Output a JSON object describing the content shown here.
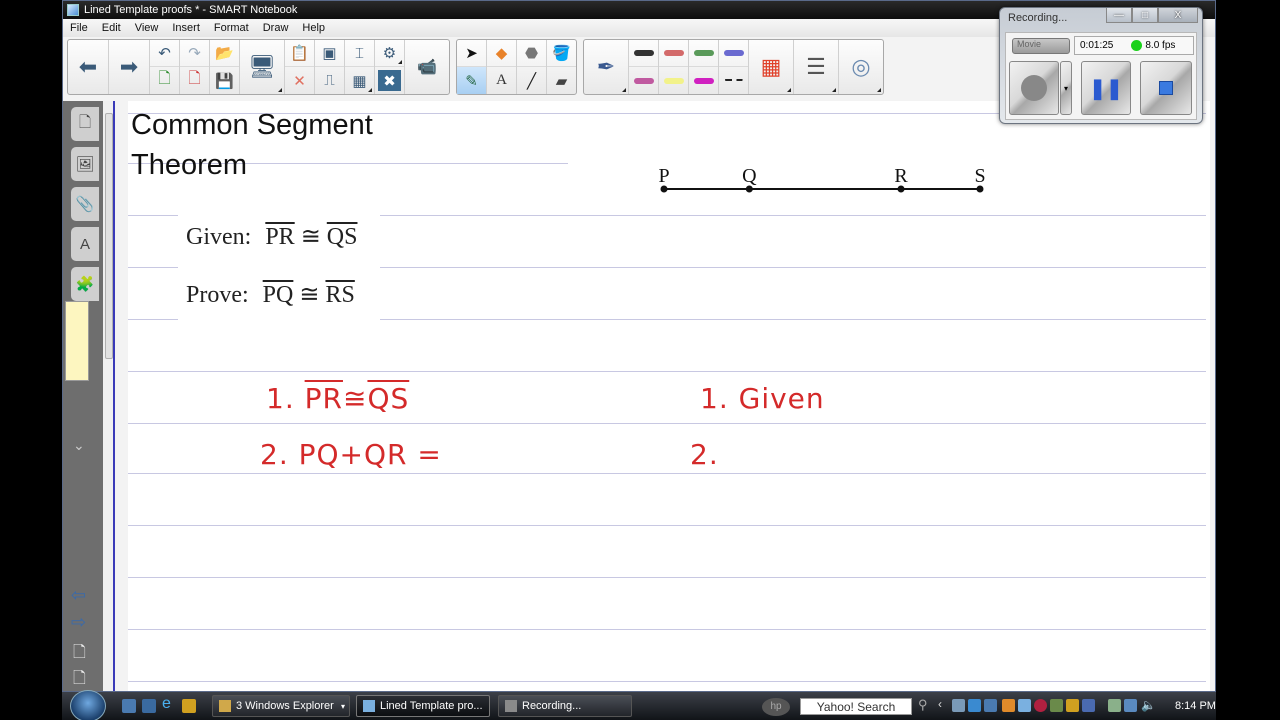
{
  "window": {
    "title": "Lined Template proofs * - SMART Notebook",
    "menu": [
      "File",
      "Edit",
      "View",
      "Insert",
      "Format",
      "Draw",
      "Help"
    ]
  },
  "toolbar": {
    "nav": [
      {
        "name": "back",
        "glyph": "⬅"
      },
      {
        "name": "forward",
        "glyph": "➡"
      }
    ],
    "page_ops_top": [
      {
        "name": "undo",
        "glyph": "↶"
      },
      {
        "name": "redo",
        "glyph": "↷"
      },
      {
        "name": "open-file",
        "glyph": "📂"
      }
    ],
    "page_ops_bottom": [
      {
        "name": "add-page",
        "glyph": "🗋"
      },
      {
        "name": "delete-page",
        "glyph": "🗋"
      },
      {
        "name": "save",
        "glyph": "💾"
      }
    ],
    "display": {
      "name": "screen-display",
      "glyph": "🖥"
    },
    "edit_top": [
      {
        "name": "paste",
        "glyph": "📋"
      },
      {
        "name": "screen-capture",
        "glyph": "▣"
      },
      {
        "name": "screen-shade",
        "glyph": "⌶"
      },
      {
        "name": "magic-pen-settings",
        "glyph": "⚙"
      }
    ],
    "edit_bottom": [
      {
        "name": "delete",
        "glyph": "✕"
      },
      {
        "name": "document-camera",
        "glyph": "⎍"
      },
      {
        "name": "insert-table",
        "glyph": "▦"
      },
      {
        "name": "full-screen",
        "glyph": "✖"
      }
    ],
    "camera": {
      "name": "camera",
      "glyph": "📹"
    },
    "tools_top": [
      {
        "name": "select",
        "glyph": "➤"
      },
      {
        "name": "shapes",
        "glyph": "◆"
      },
      {
        "name": "fill",
        "glyph": "⬣"
      },
      {
        "name": "paint-bucket",
        "glyph": "🪣"
      }
    ],
    "tools_bottom": [
      {
        "name": "pens",
        "glyph": "✎",
        "selected": true
      },
      {
        "name": "text",
        "glyph": "A"
      },
      {
        "name": "line",
        "glyph": "╱"
      },
      {
        "name": "eraser",
        "glyph": "▰"
      }
    ],
    "pen_tool": {
      "name": "pen",
      "glyph": "✒"
    },
    "pen_presets_top": [
      "#333333",
      "#d36a6a",
      "#5a9a5a",
      "#6a6ad0"
    ],
    "pen_presets_bottom": [
      "#c05aa0",
      "#f2f28a",
      "#d020c0",
      "#222222"
    ],
    "properties": [
      {
        "name": "color-palette",
        "glyph": "▦"
      },
      {
        "name": "line-style",
        "glyph": "☰"
      },
      {
        "name": "transparency",
        "glyph": "◎"
      }
    ]
  },
  "sidebar": {
    "tabs": [
      {
        "name": "page-sorter",
        "glyph": "🗋"
      },
      {
        "name": "gallery",
        "glyph": "🖼"
      },
      {
        "name": "attachments",
        "glyph": "📎"
      },
      {
        "name": "properties",
        "glyph": "A"
      },
      {
        "name": "add-ons",
        "glyph": "🧩"
      }
    ],
    "collapse_glyph": "⌄",
    "bottom": [
      {
        "name": "previous-page",
        "glyph": "⇦"
      },
      {
        "name": "next-page",
        "glyph": "⇨"
      },
      {
        "name": "add-page",
        "glyph": "🗋"
      },
      {
        "name": "delete-page",
        "glyph": "🗋"
      }
    ]
  },
  "canvas": {
    "title_line1": "Common Segment",
    "title_line2": "Theorem",
    "given_label": "Given:",
    "given_seg1": "PR",
    "given_op": "≅",
    "given_seg2": "QS",
    "prove_label": "Prove:",
    "prove_seg1": "PQ",
    "prove_op": "≅",
    "prove_seg2": "RS",
    "segment_points": [
      {
        "label": "P",
        "pos": 0
      },
      {
        "label": "Q",
        "pos": 0.27
      },
      {
        "label": "R",
        "pos": 0.75
      },
      {
        "label": "S",
        "pos": 1
      }
    ],
    "handwriting": {
      "stmt1_num": "1.",
      "stmt1_a": "PR",
      "stmt1_op": "≅",
      "stmt1_b": "QS",
      "reason1": "1. Given",
      "stmt2": "2. PQ+QR =",
      "reason2": "2."
    },
    "ink_color": "#d42a2a"
  },
  "recorder": {
    "title": "Recording...",
    "mode": "Movie",
    "elapsed": "0:01:25",
    "fps": "8.0 fps",
    "status_color": "#1ad11a",
    "min": "—",
    "max": "□",
    "close": "X"
  },
  "taskbar": {
    "tasks": [
      {
        "label": "3 Windows Explorer",
        "active": false
      },
      {
        "label": "Lined Template pro...",
        "active": true
      },
      {
        "label": "Recording...",
        "active": false
      }
    ],
    "search_label": "Yahoo! Search",
    "clock": "8:14 PM"
  }
}
